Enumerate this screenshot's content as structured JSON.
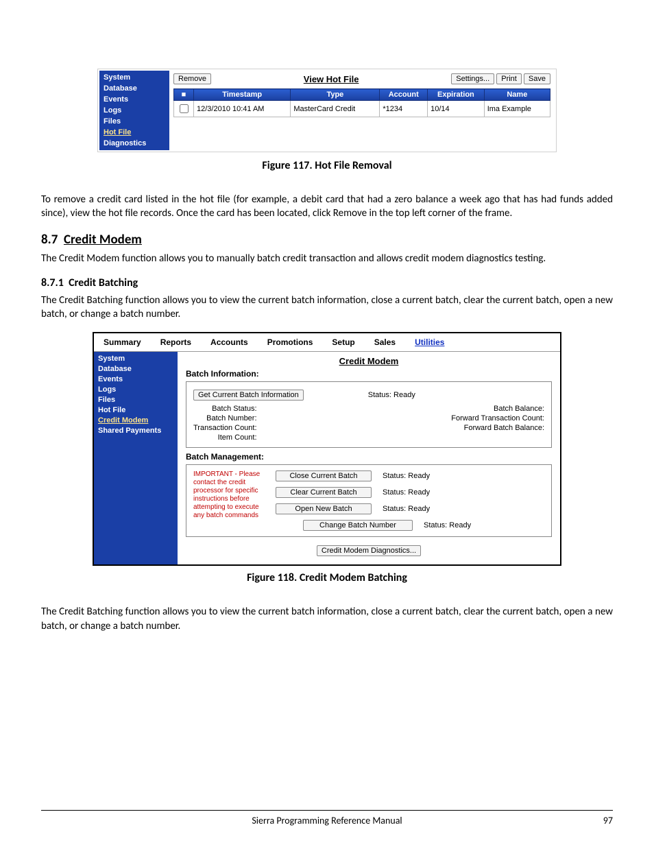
{
  "fig117": {
    "sidebar": [
      "System",
      "Database",
      "Events",
      "Logs",
      "Files",
      "Hot File",
      "Diagnostics"
    ],
    "sidebar_selected_index": 5,
    "removeBtn": "Remove",
    "title": "View Hot File",
    "settingsBtn": "Settings...",
    "printBtn": "Print",
    "saveBtn": "Save",
    "headers": [
      "",
      "Timestamp",
      "Type",
      "Account",
      "Expiration",
      "Name"
    ],
    "row": {
      "timestamp": "12/3/2010 10:41 AM",
      "type": "MasterCard Credit",
      "account": "*1234",
      "expiration": "10/14",
      "name": "Ima Example"
    },
    "caption": "Figure 117. Hot File Removal"
  },
  "para1": "To remove a credit card listed in the hot file (for example, a debit card that had a zero balance a week ago that has had funds added since), view the hot file records. Once the card has been located, click Remove in the top left corner of the frame.",
  "section": {
    "num": "8.7",
    "title": "Credit Modem"
  },
  "para2": "The Credit Modem function allows you to manually batch credit transaction and allows credit modem diagnostics testing.",
  "subsection": {
    "num": "8.7.1",
    "title": "Credit Batching"
  },
  "para3": "The Credit Batching function allows you to view the current batch information, close a current batch, clear the current batch, open a new batch, or change a batch number.",
  "fig118": {
    "tabs": [
      "Summary",
      "Reports",
      "Accounts",
      "Promotions",
      "Setup",
      "Sales",
      "Utilities"
    ],
    "tabs_active_index": 6,
    "sidebar": [
      "System",
      "Database",
      "Events",
      "Logs",
      "Files",
      "Hot File",
      "Credit Modem",
      "Shared Payments"
    ],
    "sidebar_selected_index": 6,
    "title": "Credit Modem",
    "batchInfoHead": "Batch Information:",
    "getBtn": "Get Current Batch Information",
    "getStatus": "Status: Ready",
    "leftLabels": [
      "Batch Status:",
      "Batch Number:",
      "Transaction Count:",
      "Item Count:"
    ],
    "rightLabels": [
      "Batch Balance:",
      "Forward Transaction Count:",
      "Forward Batch Balance:"
    ],
    "mgmtHead": "Batch Management:",
    "warning": "IMPORTANT - Please contact the credit processor for specific instructions before attempting to execute any batch commands",
    "btnClose": "Close Current Batch",
    "btnClear": "Clear Current Batch",
    "btnOpen": "Open New Batch",
    "btnChange": "Change Batch Number",
    "rowStatus": "Status:  Ready",
    "diagBtn": "Credit Modem Diagnostics...",
    "caption": "Figure 118. Credit Modem Batching"
  },
  "para4": "The Credit Batching function allows you to view the current batch information, close a current batch, clear the current batch, open a new batch, or change a batch number.",
  "footer": {
    "title": "Sierra Programming Reference Manual",
    "page": "97"
  }
}
